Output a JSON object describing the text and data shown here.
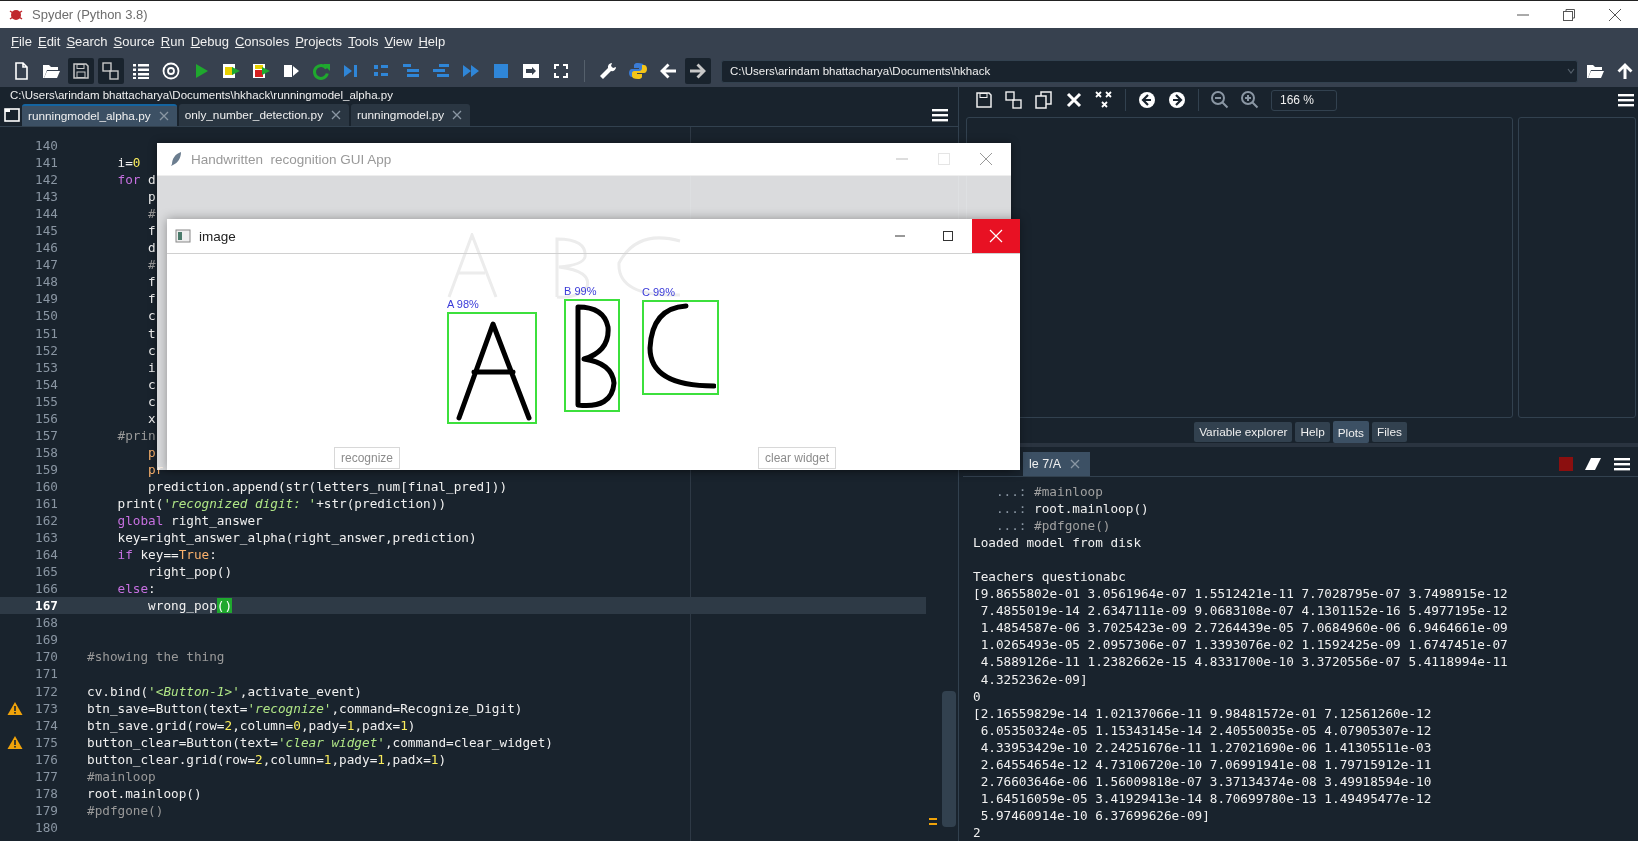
{
  "window": {
    "title": "Spyder (Python 3.8)"
  },
  "menu": [
    "File",
    "Edit",
    "Search",
    "Source",
    "Run",
    "Debug",
    "Consoles",
    "Projects",
    "Tools",
    "View",
    "Help"
  ],
  "toolbar": {
    "path": "C:\\Users\\arindam bhattacharya\\Documents\\hkhack"
  },
  "editor": {
    "file_path": "C:\\Users\\arindam bhattacharya\\Documents\\hkhack\\runningmodel_alpha.py",
    "tabs": [
      {
        "label": "runningmodel_alpha.py",
        "selected": true
      },
      {
        "label": "only_number_detection.py",
        "selected": false
      },
      {
        "label": "runningmodel.py",
        "selected": false
      }
    ],
    "lines": [
      {
        "number": "140",
        "current": false,
        "warning": false
      },
      {
        "number": "141",
        "segments": [
          {
            "text": "    i=",
            "kind": "plain"
          },
          {
            "text": "0",
            "kind": "number"
          }
        ],
        "current": false,
        "warning": false
      },
      {
        "number": "142",
        "segments": [
          {
            "text": "    for",
            "kind": "keyword"
          },
          {
            "text": " d",
            "kind": "plain"
          }
        ],
        "current": false,
        "warning": false
      },
      {
        "number": "143",
        "segments": [
          {
            "text": "        p",
            "kind": "plain"
          }
        ],
        "current": false,
        "warning": false
      },
      {
        "number": "144",
        "segments": [
          {
            "text": "        #",
            "kind": "comment"
          }
        ],
        "current": false,
        "warning": false
      },
      {
        "number": "145",
        "segments": [
          {
            "text": "        f",
            "kind": "plain"
          }
        ],
        "current": false,
        "warning": false
      },
      {
        "number": "146",
        "segments": [
          {
            "text": "        d",
            "kind": "plain"
          }
        ],
        "current": false,
        "warning": false
      },
      {
        "number": "147",
        "segments": [
          {
            "text": "        #",
            "kind": "comment"
          }
        ],
        "current": false,
        "warning": false
      },
      {
        "number": "148",
        "segments": [
          {
            "text": "        f",
            "kind": "plain"
          }
        ],
        "current": false,
        "warning": false
      },
      {
        "number": "149",
        "segments": [
          {
            "text": "        f",
            "kind": "plain"
          }
        ],
        "current": false,
        "warning": false
      },
      {
        "number": "150",
        "segments": [
          {
            "text": "        c",
            "kind": "plain"
          }
        ],
        "current": false,
        "warning": false
      },
      {
        "number": "151",
        "segments": [
          {
            "text": "        t",
            "kind": "plain"
          }
        ],
        "current": false,
        "warning": false
      },
      {
        "number": "152",
        "segments": [
          {
            "text": "        c",
            "kind": "plain"
          }
        ],
        "current": false,
        "warning": false
      },
      {
        "number": "153",
        "segments": [
          {
            "text": "        i",
            "kind": "plain"
          }
        ],
        "current": false,
        "warning": false
      },
      {
        "number": "154",
        "segments": [
          {
            "text": "        c",
            "kind": "plain"
          }
        ],
        "current": false,
        "warning": false
      },
      {
        "number": "155",
        "segments": [
          {
            "text": "        c",
            "kind": "plain"
          }
        ],
        "current": false,
        "warning": false
      },
      {
        "number": "156",
        "segments": [
          {
            "text": "        x",
            "kind": "plain"
          }
        ],
        "current": false,
        "warning": false
      },
      {
        "number": "157",
        "segments": [
          {
            "text": "    #prin",
            "kind": "comment"
          }
        ],
        "current": false,
        "warning": false
      },
      {
        "number": "158",
        "segments": [
          {
            "text": "        p",
            "kind": "builtin"
          }
        ],
        "current": false,
        "warning": false
      },
      {
        "number": "159",
        "segments": [
          {
            "text": "        pr",
            "kind": "builtin"
          }
        ],
        "current": false,
        "warning": false
      },
      {
        "number": "160",
        "segments": [
          {
            "text": "        prediction.append(str(letters_num[final_pred]))",
            "kind": "plain"
          }
        ],
        "current": false,
        "warning": false
      },
      {
        "number": "161",
        "segments": [
          {
            "text": "    print(",
            "kind": "plain"
          },
          {
            "text": "'recognized digit: '",
            "kind": "string"
          },
          {
            "text": "+str(prediction))",
            "kind": "plain"
          }
        ],
        "current": false,
        "warning": false
      },
      {
        "number": "162",
        "segments": [
          {
            "text": "    global",
            "kind": "keyword"
          },
          {
            "text": " right_answer",
            "kind": "plain"
          }
        ],
        "current": false,
        "warning": false
      },
      {
        "number": "163",
        "segments": [
          {
            "text": "    key=right_answer_alpha(right_answer,prediction)",
            "kind": "plain"
          }
        ],
        "current": false,
        "warning": false
      },
      {
        "number": "164",
        "segments": [
          {
            "text": "    if",
            "kind": "keyword"
          },
          {
            "text": " key==",
            "kind": "plain"
          },
          {
            "text": "True",
            "kind": "builtin"
          },
          {
            "text": ":",
            "kind": "plain"
          }
        ],
        "current": false,
        "warning": false
      },
      {
        "number": "165",
        "segments": [
          {
            "text": "        right_pop()",
            "kind": "plain"
          }
        ],
        "current": false,
        "warning": false
      },
      {
        "number": "166",
        "segments": [
          {
            "text": "    else",
            "kind": "keyword"
          },
          {
            "text": ":",
            "kind": "plain"
          }
        ],
        "current": false,
        "warning": false
      },
      {
        "number": "167",
        "segments": [
          {
            "text": "        wrong_pop",
            "kind": "plain"
          },
          {
            "text": "()",
            "kind": "match"
          }
        ],
        "current": true,
        "warning": false
      },
      {
        "number": "168",
        "current": false,
        "warning": false
      },
      {
        "number": "169",
        "current": false,
        "warning": false
      },
      {
        "number": "170",
        "segments": [
          {
            "text": "#showing the thing",
            "kind": "comment"
          }
        ],
        "current": false,
        "warning": false
      },
      {
        "number": "171",
        "current": false,
        "warning": false
      },
      {
        "number": "172",
        "segments": [
          {
            "text": "cv.bind(",
            "kind": "plain"
          },
          {
            "text": "'<Button-1>'",
            "kind": "string"
          },
          {
            "text": ",activate_event)",
            "kind": "plain"
          }
        ],
        "current": false,
        "warning": false
      },
      {
        "number": "173",
        "segments": [
          {
            "text": "btn_save=Button(text=",
            "kind": "plain"
          },
          {
            "text": "'recognize'",
            "kind": "string"
          },
          {
            "text": ",command=Recognize_Digit)",
            "kind": "plain"
          }
        ],
        "current": false,
        "warning": true
      },
      {
        "number": "174",
        "segments": [
          {
            "text": "btn_save.grid(row=",
            "kind": "plain"
          },
          {
            "text": "2",
            "kind": "number"
          },
          {
            "text": ",column=",
            "kind": "plain"
          },
          {
            "text": "0",
            "kind": "number"
          },
          {
            "text": ",pady=",
            "kind": "plain"
          },
          {
            "text": "1",
            "kind": "number"
          },
          {
            "text": ",padx=",
            "kind": "plain"
          },
          {
            "text": "1",
            "kind": "number"
          },
          {
            "text": ")",
            "kind": "plain"
          }
        ],
        "current": false,
        "warning": false
      },
      {
        "number": "175",
        "segments": [
          {
            "text": "button_clear=Button(text=",
            "kind": "plain"
          },
          {
            "text": "'clear widget'",
            "kind": "string"
          },
          {
            "text": ",command=clear_widget)",
            "kind": "plain"
          }
        ],
        "current": false,
        "warning": true
      },
      {
        "number": "176",
        "segments": [
          {
            "text": "button_clear.grid(row=",
            "kind": "plain"
          },
          {
            "text": "2",
            "kind": "number"
          },
          {
            "text": ",column=",
            "kind": "plain"
          },
          {
            "text": "1",
            "kind": "number"
          },
          {
            "text": ",pady=",
            "kind": "plain"
          },
          {
            "text": "1",
            "kind": "number"
          },
          {
            "text": ",padx=",
            "kind": "plain"
          },
          {
            "text": "1",
            "kind": "number"
          },
          {
            "text": ")",
            "kind": "plain"
          }
        ],
        "current": false,
        "warning": false
      },
      {
        "number": "177",
        "segments": [
          {
            "text": "#mainloop",
            "kind": "comment"
          }
        ],
        "current": false,
        "warning": false
      },
      {
        "number": "178",
        "segments": [
          {
            "text": "root.mainloop()",
            "kind": "plain"
          }
        ],
        "current": false,
        "warning": false
      },
      {
        "number": "179",
        "segments": [
          {
            "text": "#pdfgone()",
            "kind": "comment"
          }
        ],
        "current": false,
        "warning": false
      },
      {
        "number": "180",
        "current": false,
        "warning": false
      }
    ]
  },
  "plots": {
    "zoom": "166 %"
  },
  "pane_tabs": [
    {
      "label": "Variable explorer",
      "selected": false
    },
    {
      "label": "Help",
      "selected": false
    },
    {
      "label": "Plots",
      "selected": true
    },
    {
      "label": "Files",
      "selected": false
    }
  ],
  "console": {
    "tab": "le 7/A",
    "lines": [
      {
        "kind": "comment",
        "prompt": "...:",
        "text": "#mainloop"
      },
      {
        "kind": "input",
        "prompt": "...:",
        "text": "root.mainloop()"
      },
      {
        "kind": "comment",
        "prompt": "...:",
        "text": "#pdfgone()"
      },
      {
        "kind": "output",
        "text": "Loaded model from disk"
      },
      {
        "kind": "blank"
      },
      {
        "kind": "output",
        "text": "Teachers questionabc"
      },
      {
        "kind": "output",
        "text": "[9.8655802e-01 3.0561964e-07 1.5512421e-11 7.7028795e-07 3.7498915e-12"
      },
      {
        "kind": "output",
        "text": " 7.4855019e-14 2.6347111e-09 9.0683108e-07 4.1301152e-16 5.4977195e-12"
      },
      {
        "kind": "output",
        "text": " 1.4854587e-06 3.7025423e-09 2.7264439e-05 7.0684960e-06 6.9464661e-09"
      },
      {
        "kind": "output",
        "text": " 1.0265493e-05 2.0957306e-07 1.3393076e-02 1.1592425e-09 1.6747451e-07"
      },
      {
        "kind": "output",
        "text": " 4.5889126e-11 1.2382662e-15 4.8331700e-10 3.3720556e-07 5.4118994e-11"
      },
      {
        "kind": "output",
        "text": " 4.3252362e-09]"
      },
      {
        "kind": "output",
        "text": "0"
      },
      {
        "kind": "output",
        "text": "[2.16559829e-14 1.02137066e-11 9.98481572e-01 7.12561260e-12"
      },
      {
        "kind": "output",
        "text": " 6.05350324e-05 1.15343145e-14 2.40550035e-05 4.07905307e-12"
      },
      {
        "kind": "output",
        "text": " 4.33953429e-10 2.24251676e-11 1.27021690e-06 1.41305511e-03"
      },
      {
        "kind": "output",
        "text": " 2.64554654e-12 4.73106720e-10 7.06991941e-08 1.79715912e-11"
      },
      {
        "kind": "output",
        "text": " 2.76603646e-06 1.56009818e-07 3.37134374e-08 3.49918594e-10"
      },
      {
        "kind": "output",
        "text": " 1.64516059e-05 3.41929413e-14 8.70699780e-13 1.49495477e-12"
      },
      {
        "kind": "output",
        "text": " 5.97460914e-10 6.37699626e-09]"
      },
      {
        "kind": "output",
        "text": "2"
      }
    ]
  },
  "app_window": {
    "title": "Handwritten  recognition GUI App",
    "buttons": [
      "recognize",
      "clear widget"
    ]
  },
  "image_window": {
    "title": "image",
    "detections": [
      {
        "label": "A 98%",
        "kind": "letter-a"
      },
      {
        "label": "B 99%",
        "kind": "letter-b"
      },
      {
        "label": "C 99%",
        "kind": "letter-c"
      }
    ]
  }
}
